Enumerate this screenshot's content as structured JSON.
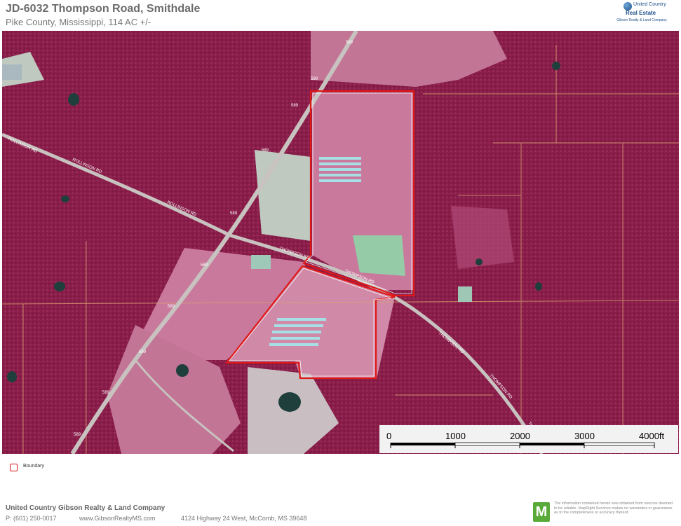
{
  "header": {
    "title": "JD-6032 Thompson Road, Smithdale",
    "subtitle": "Pike County, Mississippi, 114 AC +/-"
  },
  "logo": {
    "brand": "United Country",
    "real_estate": "Real Estate",
    "company": "Gibson Realty & Land Company"
  },
  "map": {
    "colors": {
      "forest": "#8a1e4a",
      "forest_light": "#b0306a",
      "field": "#c97a9c",
      "field_light": "#d9a0b8",
      "road": "#c8c2c0",
      "boundary": "#e01818",
      "teal": "#3f8f8a",
      "water": "#1f3f3c",
      "parcel_line": "#d9a070"
    },
    "road_labels": {
      "rollinson_1": "ROLLINSON RD",
      "rollinson_2": "ROLLINSON RD",
      "rollinson_3": "ROLLINSON RD",
      "thompson_1": "THOMPSON RD",
      "thompson_2": "THOMPSON RD",
      "thompson_3": "THOMPSON RD",
      "thompson_4": "THOMPSON RD",
      "hwy": "589"
    }
  },
  "scalebar": {
    "ticks": [
      "0",
      "1000",
      "2000",
      "3000",
      "4000ft"
    ]
  },
  "legend": {
    "boundary_label": "Boundary"
  },
  "footer": {
    "company": "United Country  Gibson Realty & Land Company",
    "phone": "P: (601) 250-0017",
    "website": "www.GibsonRealtyMS.com",
    "address": "4124 Highway 24 West, McComb, MS 39648",
    "m_logo": "M",
    "disclaimer": "The information contained herein was obtained from sources deemed to be reliable. MapRight Services makes no warranties or guarantees as to the completeness or accuracy thereof."
  }
}
